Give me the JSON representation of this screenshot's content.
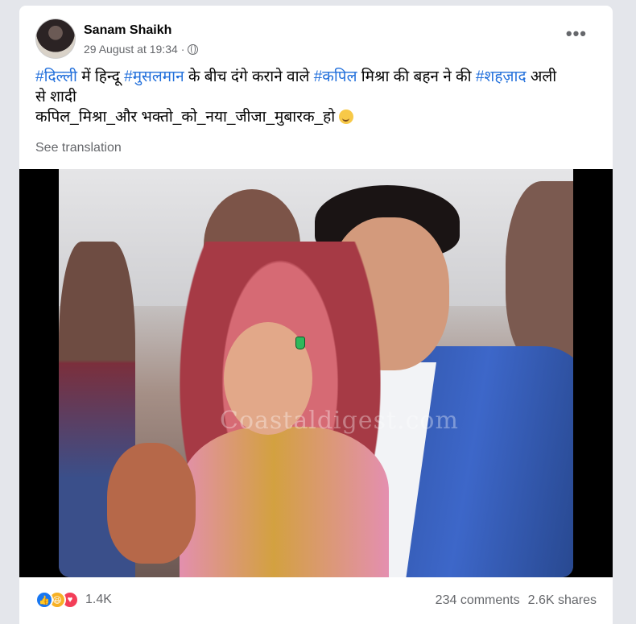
{
  "post": {
    "author": "Sanam Shaikh",
    "timestamp": "29 August at 19:34",
    "separator": "·",
    "privacy_icon": "globe-icon",
    "more_label": "•••",
    "text_lines": [
      [
        {
          "t": "#दिल्ली",
          "tag": true
        },
        {
          "t": " में हिन्दू ",
          "tag": false
        },
        {
          "t": "#मुसलमान",
          "tag": true
        },
        {
          "t": " के बीच दंगे कराने वाले ",
          "tag": false
        },
        {
          "t": "#कपिल",
          "tag": true
        },
        {
          "t": " मिश्रा की बहन ने की ",
          "tag": false
        },
        {
          "t": "#शहज़ाद",
          "tag": true
        },
        {
          "t": " अली",
          "tag": false
        }
      ],
      [
        {
          "t": "से शादी",
          "tag": false
        }
      ],
      [
        {
          "t": "कपिल_मिश्रा_और भक्तो_को_नया_जीजा_मुबारक_हो ",
          "tag": false
        }
      ]
    ],
    "see_translation": "See translation",
    "image_watermark": "Coastaldigest.com"
  },
  "footer": {
    "reactions": [
      "like-icon",
      "haha-icon",
      "love-icon"
    ],
    "reaction_count": "1.4K",
    "comments": "234 comments",
    "shares": "2.6K shares"
  },
  "colors": {
    "hashtag": "#216fdb",
    "secondary_text": "#65676b",
    "background": "#e4e6eb"
  }
}
